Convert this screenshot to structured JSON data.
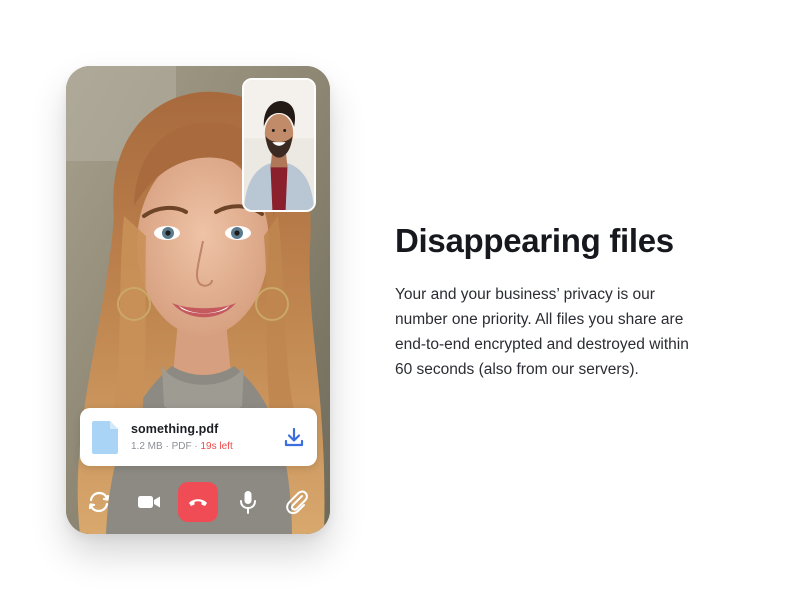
{
  "call": {
    "main_participant": "woman-portrait",
    "pip_participant": "man-portrait"
  },
  "file_card": {
    "name": "something.pdf",
    "size": "1.2 MB",
    "type": "PDF",
    "separator": "·",
    "timer": "19s left",
    "file_icon": "document-icon",
    "action_icon": "download-icon"
  },
  "controls": [
    {
      "name": "switch-camera",
      "icon": "rotate-icon"
    },
    {
      "name": "video",
      "icon": "video-camera-icon"
    },
    {
      "name": "end-call",
      "icon": "phone-hangup-icon"
    },
    {
      "name": "microphone",
      "icon": "microphone-icon"
    },
    {
      "name": "attach",
      "icon": "paperclip-icon"
    }
  ],
  "feature": {
    "title": "Disappearing files",
    "body_lines": [
      "Your and your business’ privacy is our",
      "number one priority. All files you share are",
      "end-to-end encrypted and destroyed within",
      "60 seconds (also from our servers)."
    ]
  },
  "colors": {
    "end_call": "#f04c56",
    "timer_text": "#ef4b4b",
    "download_icon": "#3b6fe0",
    "file_icon": "#a9d4f5",
    "heading": "#16181d"
  }
}
